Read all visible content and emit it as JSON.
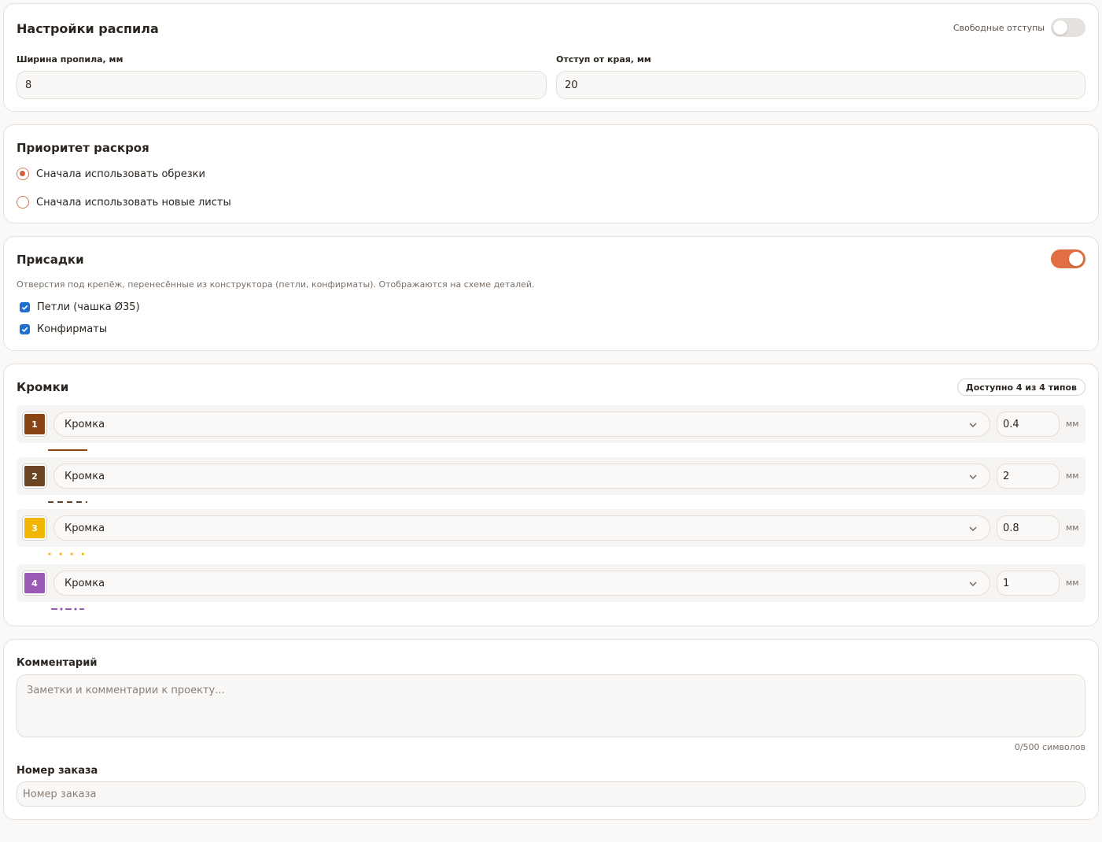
{
  "saw": {
    "title": "Настройки распила",
    "free_margins_label": "Свободные отступы",
    "free_margins_on": false,
    "kerf_label": "Ширина пропила, мм",
    "kerf_value": "8",
    "edge_offset_label": "Отступ от края, мм",
    "edge_offset_value": "20"
  },
  "priority": {
    "title": "Приоритет раскроя",
    "options": [
      {
        "label": "Сначала использовать обрезки",
        "selected": true
      },
      {
        "label": "Сначала использовать новые листы",
        "selected": false
      }
    ]
  },
  "drilling": {
    "title": "Присадки",
    "enabled": true,
    "description": "Отверстия под крепёж, перенесённые из конструктора (петли, конфирматы). Отображаются на схеме деталей.",
    "options": [
      {
        "label": "Петли (чашка Ø35)",
        "checked": true
      },
      {
        "label": "Конфирматы",
        "checked": true
      }
    ]
  },
  "edges": {
    "title": "Кромки",
    "badge": "Доступно 4 из 4 типов",
    "unit": "мм",
    "items": [
      {
        "index": "1",
        "name": "Кромка",
        "thickness": "0.4",
        "color": "#8a4514",
        "pattern": "solid"
      },
      {
        "index": "2",
        "name": "Кромка",
        "thickness": "2",
        "color": "#6b4423",
        "pattern": "dashed"
      },
      {
        "index": "3",
        "name": "Кромка",
        "thickness": "0.8",
        "color": "#f2b705",
        "pattern": "dotted"
      },
      {
        "index": "4",
        "name": "Кромка",
        "thickness": "1",
        "color": "#9b59b6",
        "pattern": "dash-dot"
      }
    ]
  },
  "notes": {
    "comment_label": "Комментарий",
    "comment_placeholder": "Заметки и комментарии к проекту...",
    "counter": "0/500 символов",
    "order_label": "Номер заказа",
    "order_placeholder": "Номер заказа"
  },
  "colors": {
    "accent": "#e07044",
    "checkbox": "#1f6fd1"
  }
}
